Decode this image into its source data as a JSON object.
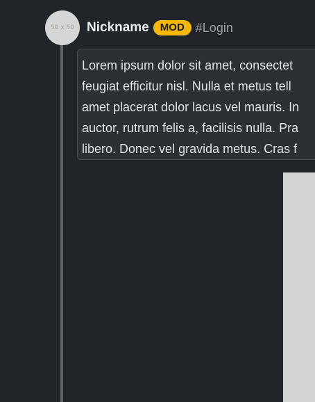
{
  "post": {
    "avatar_label": "50 x 50",
    "nickname": "Nickname",
    "badge": "MOD",
    "tag": "#Login",
    "lines": [
      "Lorem ipsum dolor sit amet, consectet",
      "feugiat efficitur nisl. Nulla et metus tell",
      "amet placerat dolor lacus vel mauris. In",
      "auctor, rutrum felis a, facilisis nulla. Pra",
      "libero. Donec vel gravida metus. Cras f"
    ]
  },
  "colors": {
    "background": "#212529",
    "badge": "#f7b900",
    "thread_line": "#5f6368",
    "placeholder": "#d3d3d3"
  }
}
